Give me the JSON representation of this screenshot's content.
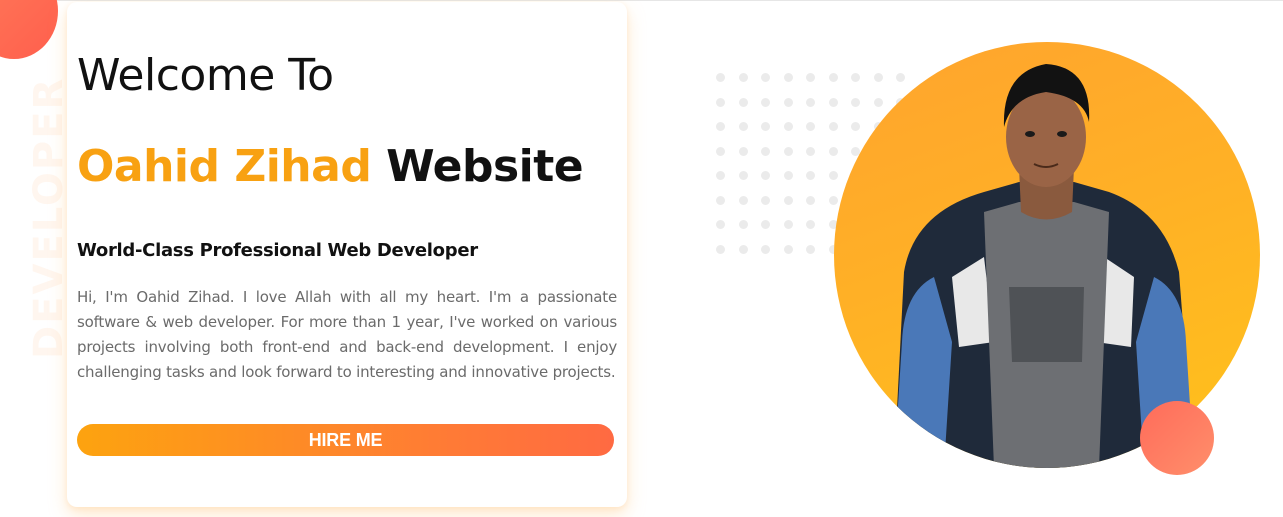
{
  "decor": {
    "vertical_text": "DEVELOPER"
  },
  "hero": {
    "title_line1": "Welcome To",
    "name_highlight": "Oahid Zihad",
    "title_suffix": "Website",
    "subtitle": "World-Class Professional Web Developer",
    "bio": "Hi, I'm Oahid Zihad. I love Allah with all my heart. I'm a passionate software & web developer. For more than 1 year, I've worked on various projects involving both front-end and back-end development. I enjoy challenging tasks and look forward to interesting and innovative projects.",
    "hire_button_label": "HIRE ME"
  },
  "colors": {
    "accent": "#f8a112",
    "button_gradient_start": "#fda30f",
    "button_gradient_end": "#ff6a42",
    "blob": "#ff6b5a",
    "portrait_bg": "#ffb026"
  }
}
